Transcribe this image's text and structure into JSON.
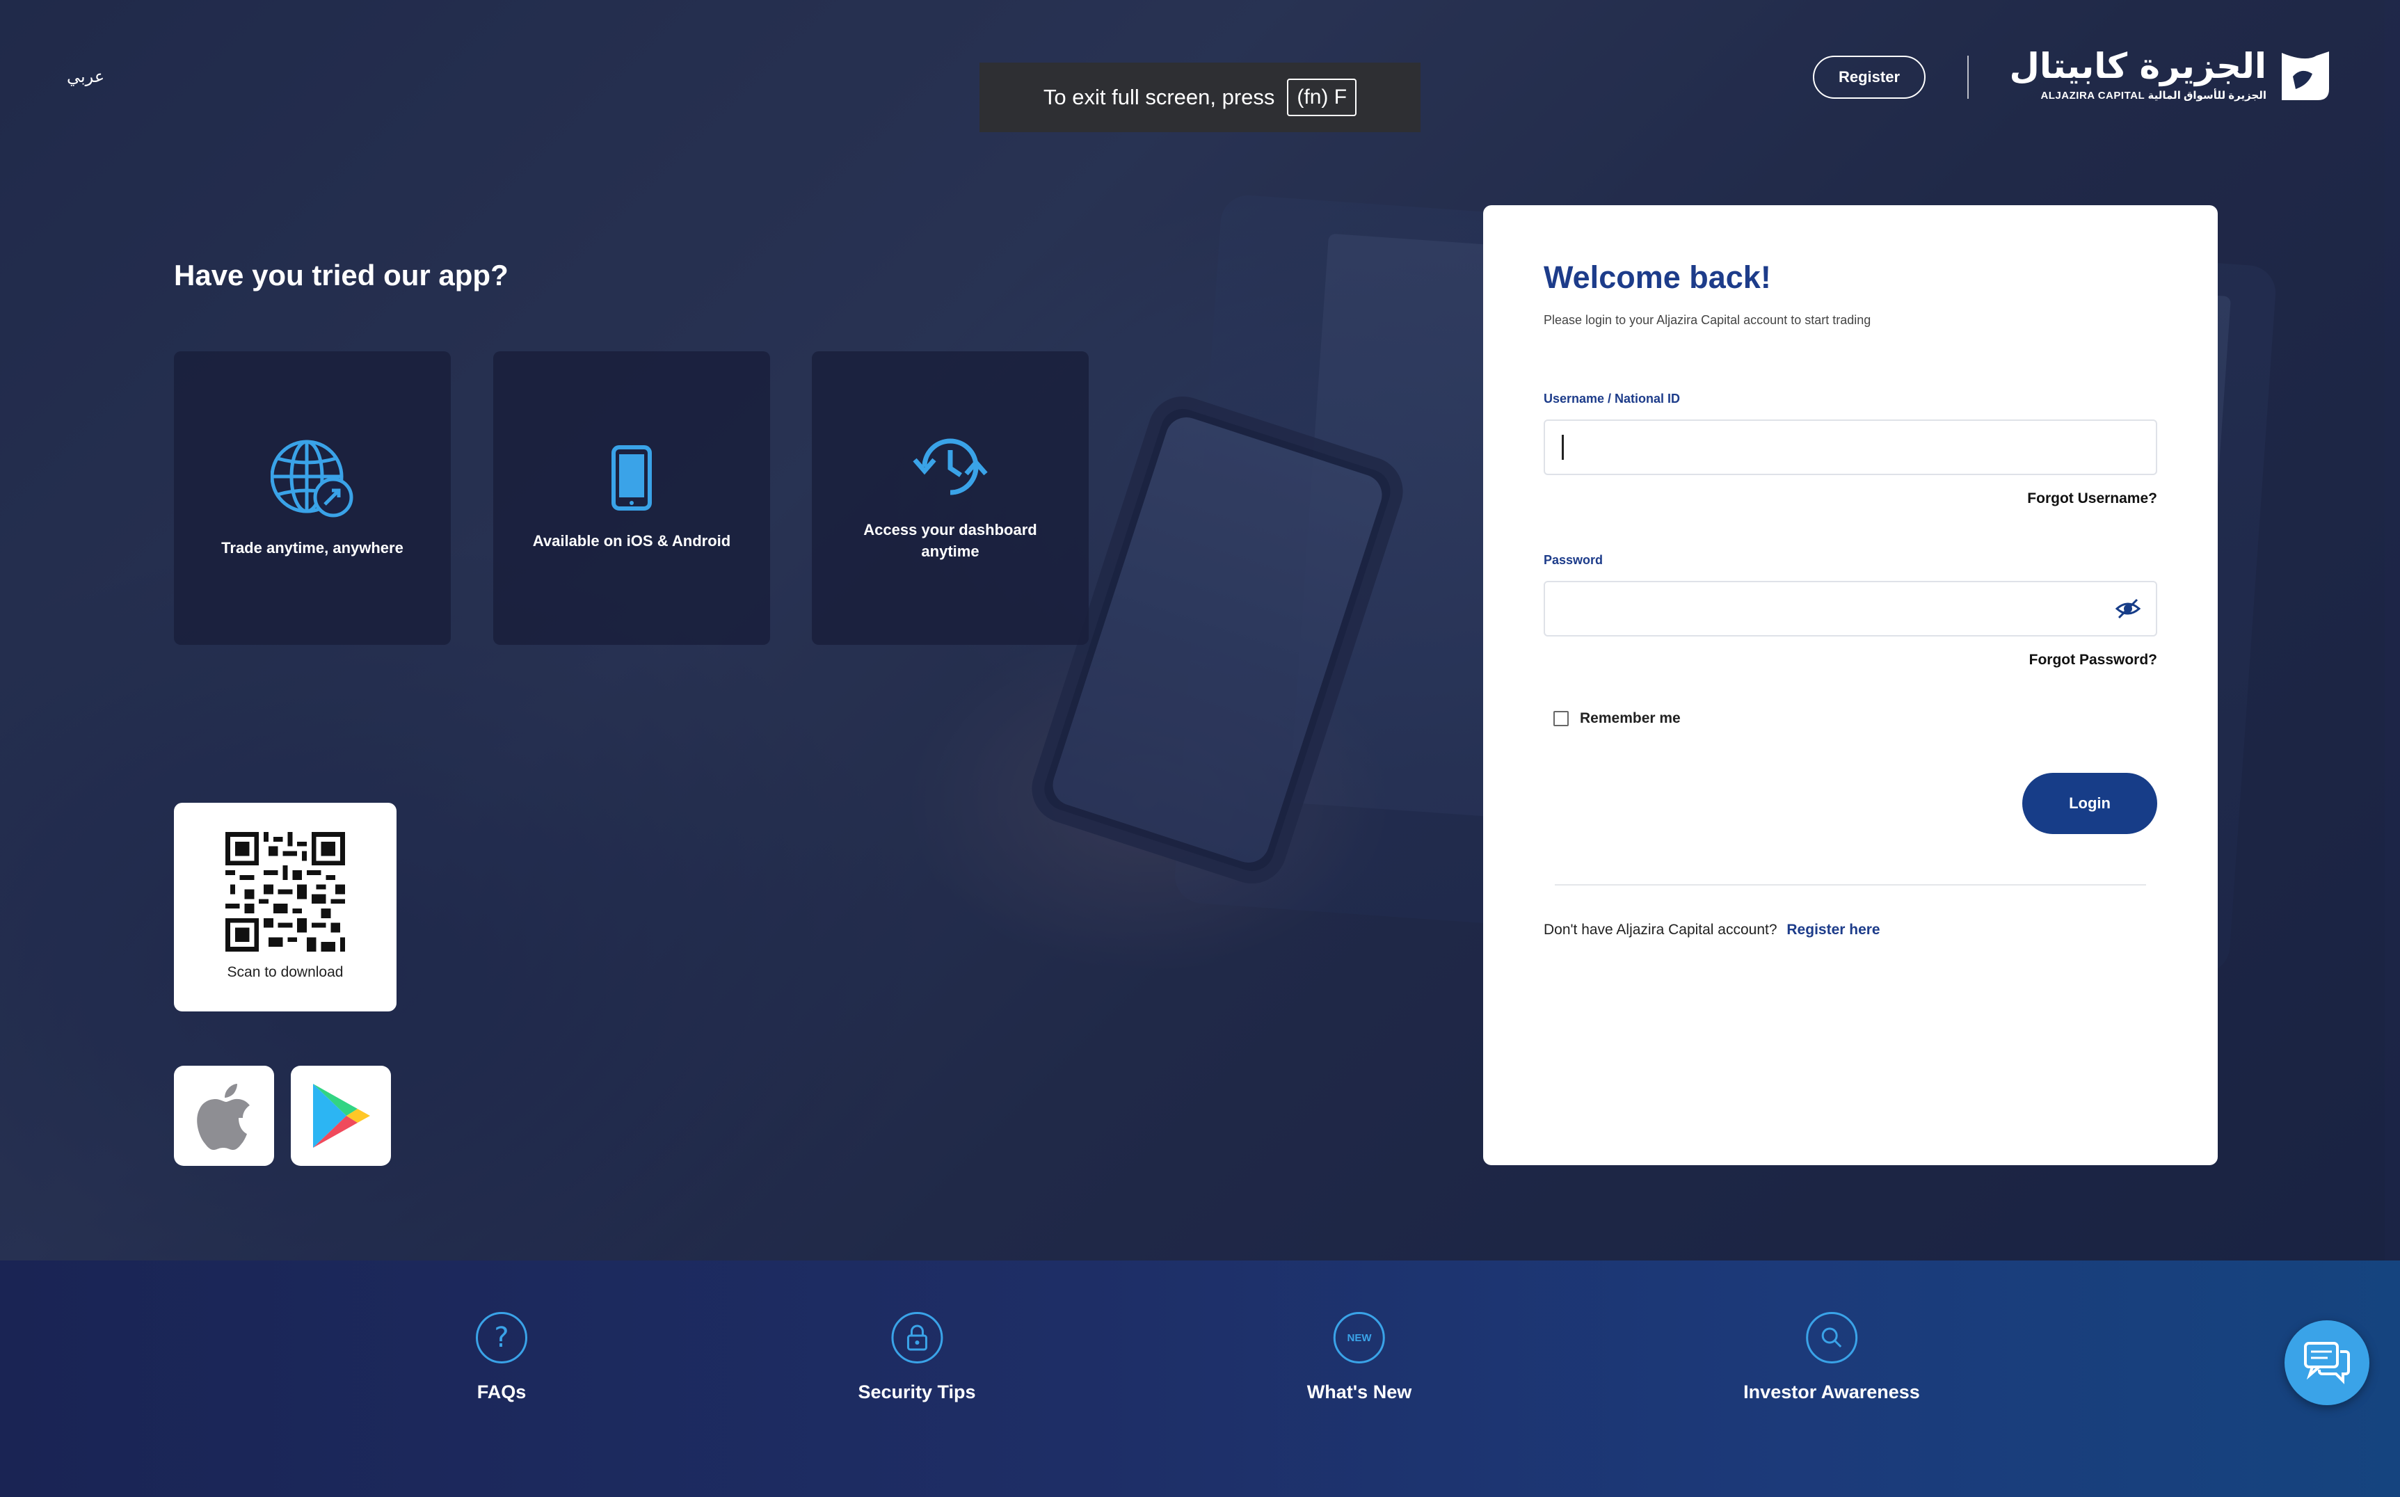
{
  "header": {
    "lang_toggle": "عربي",
    "register_label": "Register",
    "logo_arabic": "الجزيرة كابيتال",
    "logo_english": "ALJAZIRA CAPITAL الجزيرة للأسواق المالية"
  },
  "fullscreen_toast": {
    "text": "To exit full screen, press",
    "key": "(fn) F"
  },
  "promo": {
    "title": "Have you tried our app?",
    "features": [
      {
        "label": "Trade anytime, anywhere",
        "icon": "globe-trade-icon"
      },
      {
        "label": "Available on iOS & Android",
        "icon": "smartphone-icon"
      },
      {
        "label": "Access your dashboard anytime",
        "icon": "history-refresh-icon"
      }
    ],
    "qr_label": "Scan to download",
    "stores": [
      "apple-app-store",
      "google-play-store"
    ]
  },
  "login": {
    "title": "Welcome back!",
    "subtitle": "Please login to your Aljazira Capital account to start trading",
    "username_label": "Username / National ID",
    "username_value": "",
    "forgot_username": "Forgot Username?",
    "password_label": "Password",
    "password_value": "",
    "forgot_password": "Forgot Password?",
    "remember_label": "Remember me",
    "remember_checked": false,
    "login_button": "Login",
    "no_account_text": "Don't have Aljazira Capital account?",
    "register_link": "Register here"
  },
  "footer": {
    "items": [
      {
        "label": "FAQs",
        "icon": "question-icon"
      },
      {
        "label": "Security Tips",
        "icon": "lock-icon"
      },
      {
        "label": "What's New",
        "icon": "new-badge-icon",
        "badge_text": "NEW"
      },
      {
        "label": "Investor Awareness",
        "icon": "search-icon"
      }
    ]
  },
  "colors": {
    "brand_blue": "#173d88",
    "accent_blue": "#3aa3e8",
    "footer_bg": "#1c3a7a"
  }
}
